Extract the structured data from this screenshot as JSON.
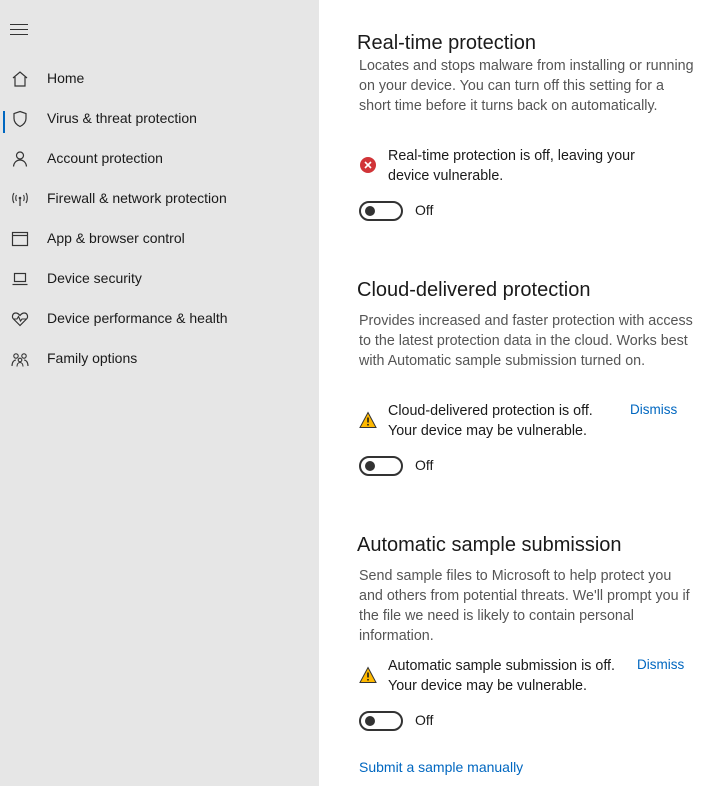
{
  "sidebar": {
    "items": [
      {
        "label": "Home",
        "icon": "home-icon"
      },
      {
        "label": "Virus & threat protection",
        "icon": "shield-icon",
        "active": true
      },
      {
        "label": "Account protection",
        "icon": "person-icon"
      },
      {
        "label": "Firewall & network protection",
        "icon": "antenna-icon"
      },
      {
        "label": "App & browser control",
        "icon": "window-icon"
      },
      {
        "label": "Device security",
        "icon": "laptop-icon"
      },
      {
        "label": "Device performance & health",
        "icon": "heart-pulse-icon"
      },
      {
        "label": "Family options",
        "icon": "family-icon"
      }
    ]
  },
  "sections": {
    "realtime": {
      "title": "Real-time protection",
      "desc": "Locates and stops malware from installing or running on your device. You can turn off this setting for a short time before it turns back on automatically.",
      "status_line1": "Real-time protection is off, leaving your",
      "status_line2": "device vulnerable.",
      "toggle_label": "Off",
      "toggle_on": false
    },
    "cloud": {
      "title": "Cloud-delivered protection",
      "desc": "Provides increased and faster protection with access to the latest protection data in the cloud. Works best with Automatic sample submission turned on.",
      "status_line1": "Cloud-delivered protection is off.",
      "status_line2": "Your device may be vulnerable.",
      "dismiss": "Dismiss",
      "toggle_label": "Off",
      "toggle_on": false
    },
    "sample": {
      "title": "Automatic sample submission",
      "desc": "Send sample files to Microsoft to help protect you and others from potential threats. We'll prompt you if the file we need is likely to contain personal information.",
      "status_line1": "Automatic sample submission is off.",
      "status_line2": "Your device may be vulnerable.",
      "dismiss": "Dismiss",
      "toggle_label": "Off",
      "toggle_on": false
    }
  },
  "links": {
    "submit_manually": "Submit a sample manually"
  },
  "colors": {
    "accent": "#0067c0",
    "error": "#d13438",
    "warning": "#ffb900",
    "sidebar_bg": "#e6e6e6"
  }
}
